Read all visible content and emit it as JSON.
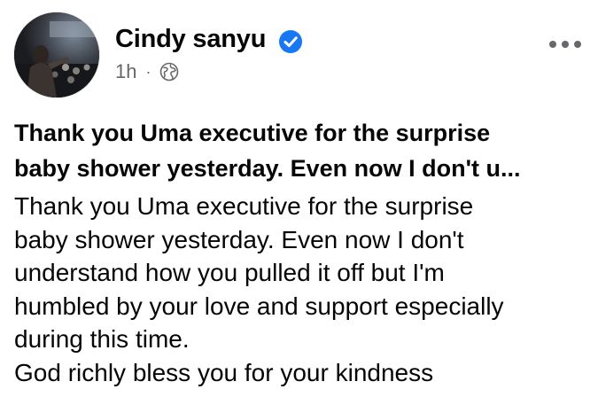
{
  "post": {
    "author": "Cindy sanyu",
    "timestamp": "1h",
    "separator": "·",
    "privacy_icon": "globe-icon",
    "verified_icon": "verified-badge-icon",
    "more_icon": "more-options-icon",
    "headline_line1": "Thank you Uma executive for the surprise",
    "headline_line2": "baby shower yesterday. Even now I don't u...",
    "body": "Thank you Uma executive for the surprise\nbaby shower yesterday. Even now I don't\nunderstand how you pulled it off but I'm\nhumbled by your love and support especially\nduring this time.\nGod richly bless you for your kindness"
  },
  "colors": {
    "verified_blue": "#1877f2",
    "meta_gray": "#65676b",
    "text": "#050505"
  }
}
